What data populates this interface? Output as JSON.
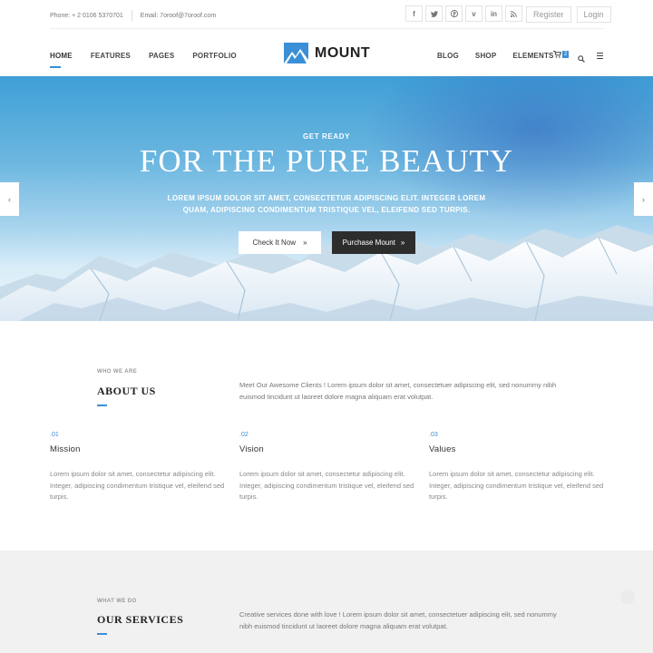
{
  "topbar": {
    "phone": "Phone: + 2 0106 5370701",
    "email": "Email: 7oroof@7oroof.com",
    "socials": [
      "facebook-icon",
      "twitter-icon",
      "pinterest-icon",
      "vimeo-icon",
      "linkedin-icon",
      "rss-icon"
    ],
    "register_label": "Register",
    "login_label": "Login"
  },
  "nav": {
    "left_items": [
      {
        "label": "HOME"
      },
      {
        "label": "FEATURES"
      },
      {
        "label": "PAGES"
      },
      {
        "label": "PORTFOLIO"
      }
    ],
    "brand": "MOUNT",
    "right_items": [
      {
        "label": "BLOG"
      },
      {
        "label": "SHOP"
      },
      {
        "label": "ELEMENTS"
      }
    ],
    "cart_count": "2",
    "accent": "#3b8fd6"
  },
  "hero": {
    "kicker": "GET READY",
    "title": "FOR THE PURE BEAUTY",
    "subtitle": "LOREM IPSUM DOLOR SIT AMET, CONSECTETUR ADIPISCING ELIT. INTEGER LOREM QUAM, ADIPISCING CONDIMENTUM TRISTIQUE VEL, ELEIFEND SED TURPIS.",
    "primary_button": "Check It Now",
    "secondary_button": "Purchase Mount"
  },
  "about": {
    "kicker": "WHO WE ARE",
    "title": "ABOUT US",
    "intro": "Meet Our Awesome Clients ! Lorem ipsum dolor sit amet, consectetuer adipiscing elit, sed nonummy nibh euismod tincidunt ut laoreet dolore magna aliquam erat volutpat.",
    "columns": [
      {
        "num": ".01",
        "title": "Mission",
        "text": "Lorem ipsum dolor sit amet, consectetur adipiscing elit. Integer, adipiscing condimentum tristique vel, eleifend sed turpis."
      },
      {
        "num": ".02",
        "title": "Vision",
        "text": "Lorem ipsum dolor sit amet, consectetur adipiscing elit. Integer, adipiscing condimentum tristique vel, eleifend sed turpis."
      },
      {
        "num": ".03",
        "title": "Values",
        "text": "Lorem ipsum dolor sit amet, consectetur adipiscing elit. Integer, adipiscing condimentum tristique vel, eleifend sed turpis."
      }
    ]
  },
  "services": {
    "kicker": "WHAT WE DO",
    "title": "OUR SERVICES",
    "intro": "Creative services done with love ! Lorem ipsum dolor sit amet, consectetuer adipiscing elit, sed nonummy nibh euismod tincidunt ut laoreet dolore magna aliquam erat volutpat."
  }
}
